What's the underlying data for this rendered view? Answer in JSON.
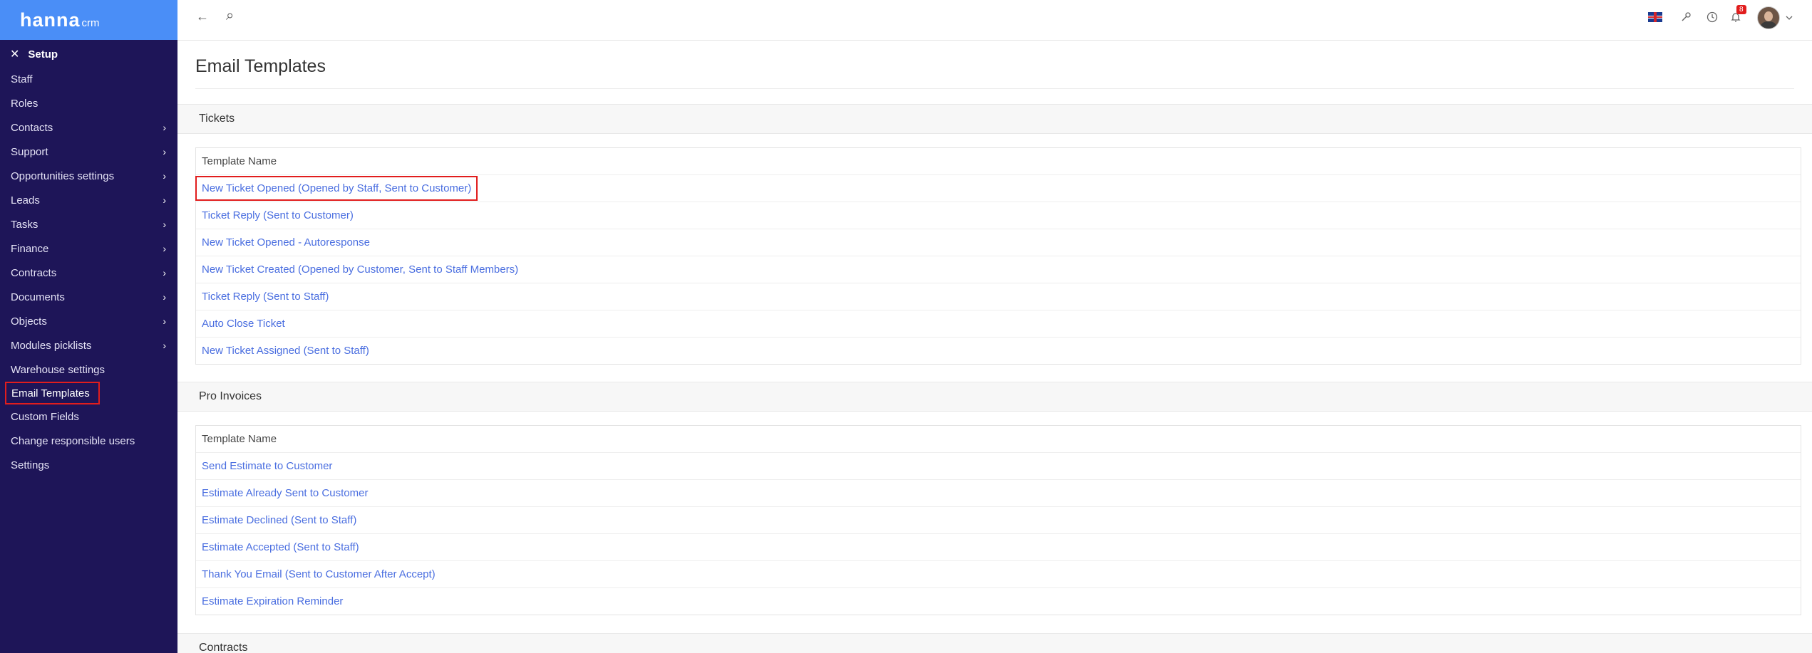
{
  "brand": {
    "name": "hanna",
    "suffix": "crm"
  },
  "sidebar": {
    "setup_label": "Setup",
    "close_icon": "✕",
    "items": [
      {
        "label": "Staff",
        "has_children": false
      },
      {
        "label": "Roles",
        "has_children": false
      },
      {
        "label": "Contacts",
        "has_children": true
      },
      {
        "label": "Support",
        "has_children": true
      },
      {
        "label": "Opportunities settings",
        "has_children": true
      },
      {
        "label": "Leads",
        "has_children": true
      },
      {
        "label": "Tasks",
        "has_children": true
      },
      {
        "label": "Finance",
        "has_children": true
      },
      {
        "label": "Contracts",
        "has_children": true
      },
      {
        "label": "Documents",
        "has_children": true
      },
      {
        "label": "Objects",
        "has_children": true
      },
      {
        "label": "Modules picklists",
        "has_children": true
      },
      {
        "label": "Warehouse settings",
        "has_children": false
      },
      {
        "label": "Email Templates",
        "has_children": false,
        "active": true
      },
      {
        "label": "Custom Fields",
        "has_children": false
      },
      {
        "label": "Change responsible users",
        "has_children": false
      },
      {
        "label": "Settings",
        "has_children": false
      }
    ]
  },
  "topbar": {
    "back_icon": "←",
    "search_icon": "⌕",
    "notification_count": "8",
    "icons": [
      "uk-flag-icon",
      "tools-icon",
      "clock-icon",
      "bell-icon",
      "avatar"
    ]
  },
  "main": {
    "page_title": "Email Templates",
    "sections": [
      {
        "title": "Tickets",
        "column_header": "Template Name",
        "rows": [
          "New Ticket Opened (Opened by Staff, Sent to Customer)",
          "Ticket Reply (Sent to Customer)",
          "New Ticket Opened - Autoresponse",
          "New Ticket Created (Opened by Customer, Sent to Staff Members)",
          "Ticket Reply (Sent to Staff)",
          "Auto Close Ticket",
          "New Ticket Assigned (Sent to Staff)"
        ]
      },
      {
        "title": "Pro Invoices",
        "column_header": "Template Name",
        "rows": [
          "Send Estimate to Customer",
          "Estimate Already Sent to Customer",
          "Estimate Declined (Sent to Staff)",
          "Estimate Accepted (Sent to Staff)",
          "Thank You Email (Sent to Customer After Accept)",
          "Estimate Expiration Reminder"
        ]
      },
      {
        "title": "Contracts"
      }
    ]
  },
  "colors": {
    "sidebar_bg": "#1e1558",
    "logo_bar_bg": "#4a8ef7",
    "link": "#4a6ee0",
    "highlight_border": "#e11d1d",
    "badge": "#e11d1d"
  }
}
